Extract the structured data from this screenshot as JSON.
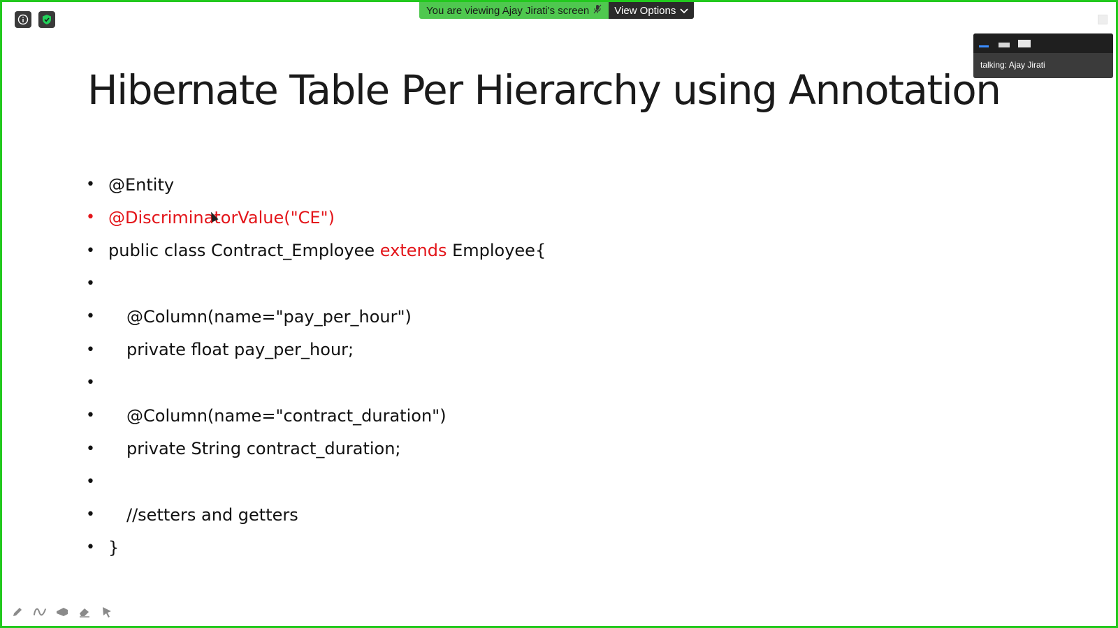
{
  "share_banner": {
    "viewing_text": "You are viewing Ajay Jirati's screen",
    "view_options_label": "View Options"
  },
  "speaker_panel": {
    "talking_label": "talking:",
    "speaker_name": "Ajay Jirati"
  },
  "slide": {
    "title": "Hibernate Table Per Hierarchy using Annotation",
    "bullets": [
      {
        "segments": [
          {
            "text": "@Entity",
            "color": "#111111"
          }
        ]
      },
      {
        "segments": [
          {
            "text": "@DiscriminatorValue(\"CE\")",
            "color": "#e3151a"
          }
        ],
        "bullet_color": "#e3151a"
      },
      {
        "segments": [
          {
            "text": "public class Contract_Employee ",
            "color": "#111111"
          },
          {
            "text": "extends",
            "color": "#e3151a"
          },
          {
            "text": " Employee{",
            "color": "#111111"
          }
        ]
      },
      {
        "segments": [
          {
            "text": "",
            "color": "#111111"
          }
        ]
      },
      {
        "segments": [
          {
            "text": "@Column(name=\"pay_per_hour\")",
            "color": "#111111"
          }
        ],
        "indent": true
      },
      {
        "segments": [
          {
            "text": "private float pay_per_hour;",
            "color": "#111111"
          }
        ],
        "indent": true
      },
      {
        "segments": [
          {
            "text": "",
            "color": "#111111"
          }
        ]
      },
      {
        "segments": [
          {
            "text": "@Column(name=\"contract_duration\")",
            "color": "#111111"
          }
        ],
        "indent": true
      },
      {
        "segments": [
          {
            "text": "private String contract_duration;",
            "color": "#111111"
          }
        ],
        "indent": true
      },
      {
        "segments": [
          {
            "text": "",
            "color": "#111111"
          }
        ]
      },
      {
        "segments": [
          {
            "text": "//setters and getters",
            "color": "#111111"
          }
        ],
        "indent": true
      },
      {
        "segments": [
          {
            "text": "}",
            "color": "#111111"
          }
        ]
      }
    ]
  },
  "colors": {
    "frame_border": "#22c91e",
    "banner_green": "#4fc84f",
    "keyword_red": "#e3151a"
  },
  "icons": {
    "top_left": [
      "info-icon",
      "shield-check-icon"
    ],
    "annotation_tools": [
      "pen-icon",
      "squiggle-icon",
      "spotlight-icon",
      "eraser-icon",
      "arrow-pointer-icon"
    ]
  }
}
